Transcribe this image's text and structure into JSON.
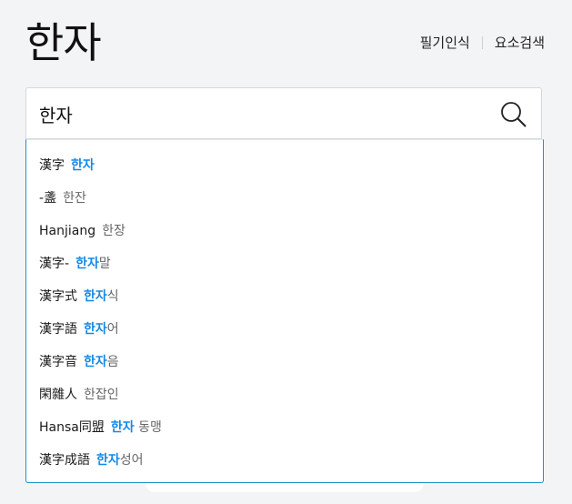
{
  "header": {
    "title": "한자",
    "links": [
      {
        "label": "필기인식"
      },
      {
        "label": "요소검색"
      }
    ]
  },
  "search": {
    "value": "한자",
    "icon": "search-icon"
  },
  "suggestions": [
    {
      "hanja": "漢字",
      "highlight": "한자",
      "rest": ""
    },
    {
      "hanja": "-盞",
      "highlight": "",
      "rest": "한잔"
    },
    {
      "hanja": "Hanjiang",
      "highlight": "",
      "rest": "한장"
    },
    {
      "hanja": "漢字-",
      "highlight": "한자",
      "rest": "말"
    },
    {
      "hanja": "漢字式",
      "highlight": "한자",
      "rest": "식"
    },
    {
      "hanja": "漢字語",
      "highlight": "한자",
      "rest": "어"
    },
    {
      "hanja": "漢字音",
      "highlight": "한자",
      "rest": "음"
    },
    {
      "hanja": "閑雜人",
      "highlight": "",
      "rest": "한잡인"
    },
    {
      "hanja": "Hansa同盟",
      "highlight": "한자",
      "rest": " 동맹"
    },
    {
      "hanja": "漢字成語",
      "highlight": "한자",
      "rest": "성어"
    }
  ],
  "colors": {
    "highlight": "#1589e6",
    "border_active": "#1a93c8"
  }
}
